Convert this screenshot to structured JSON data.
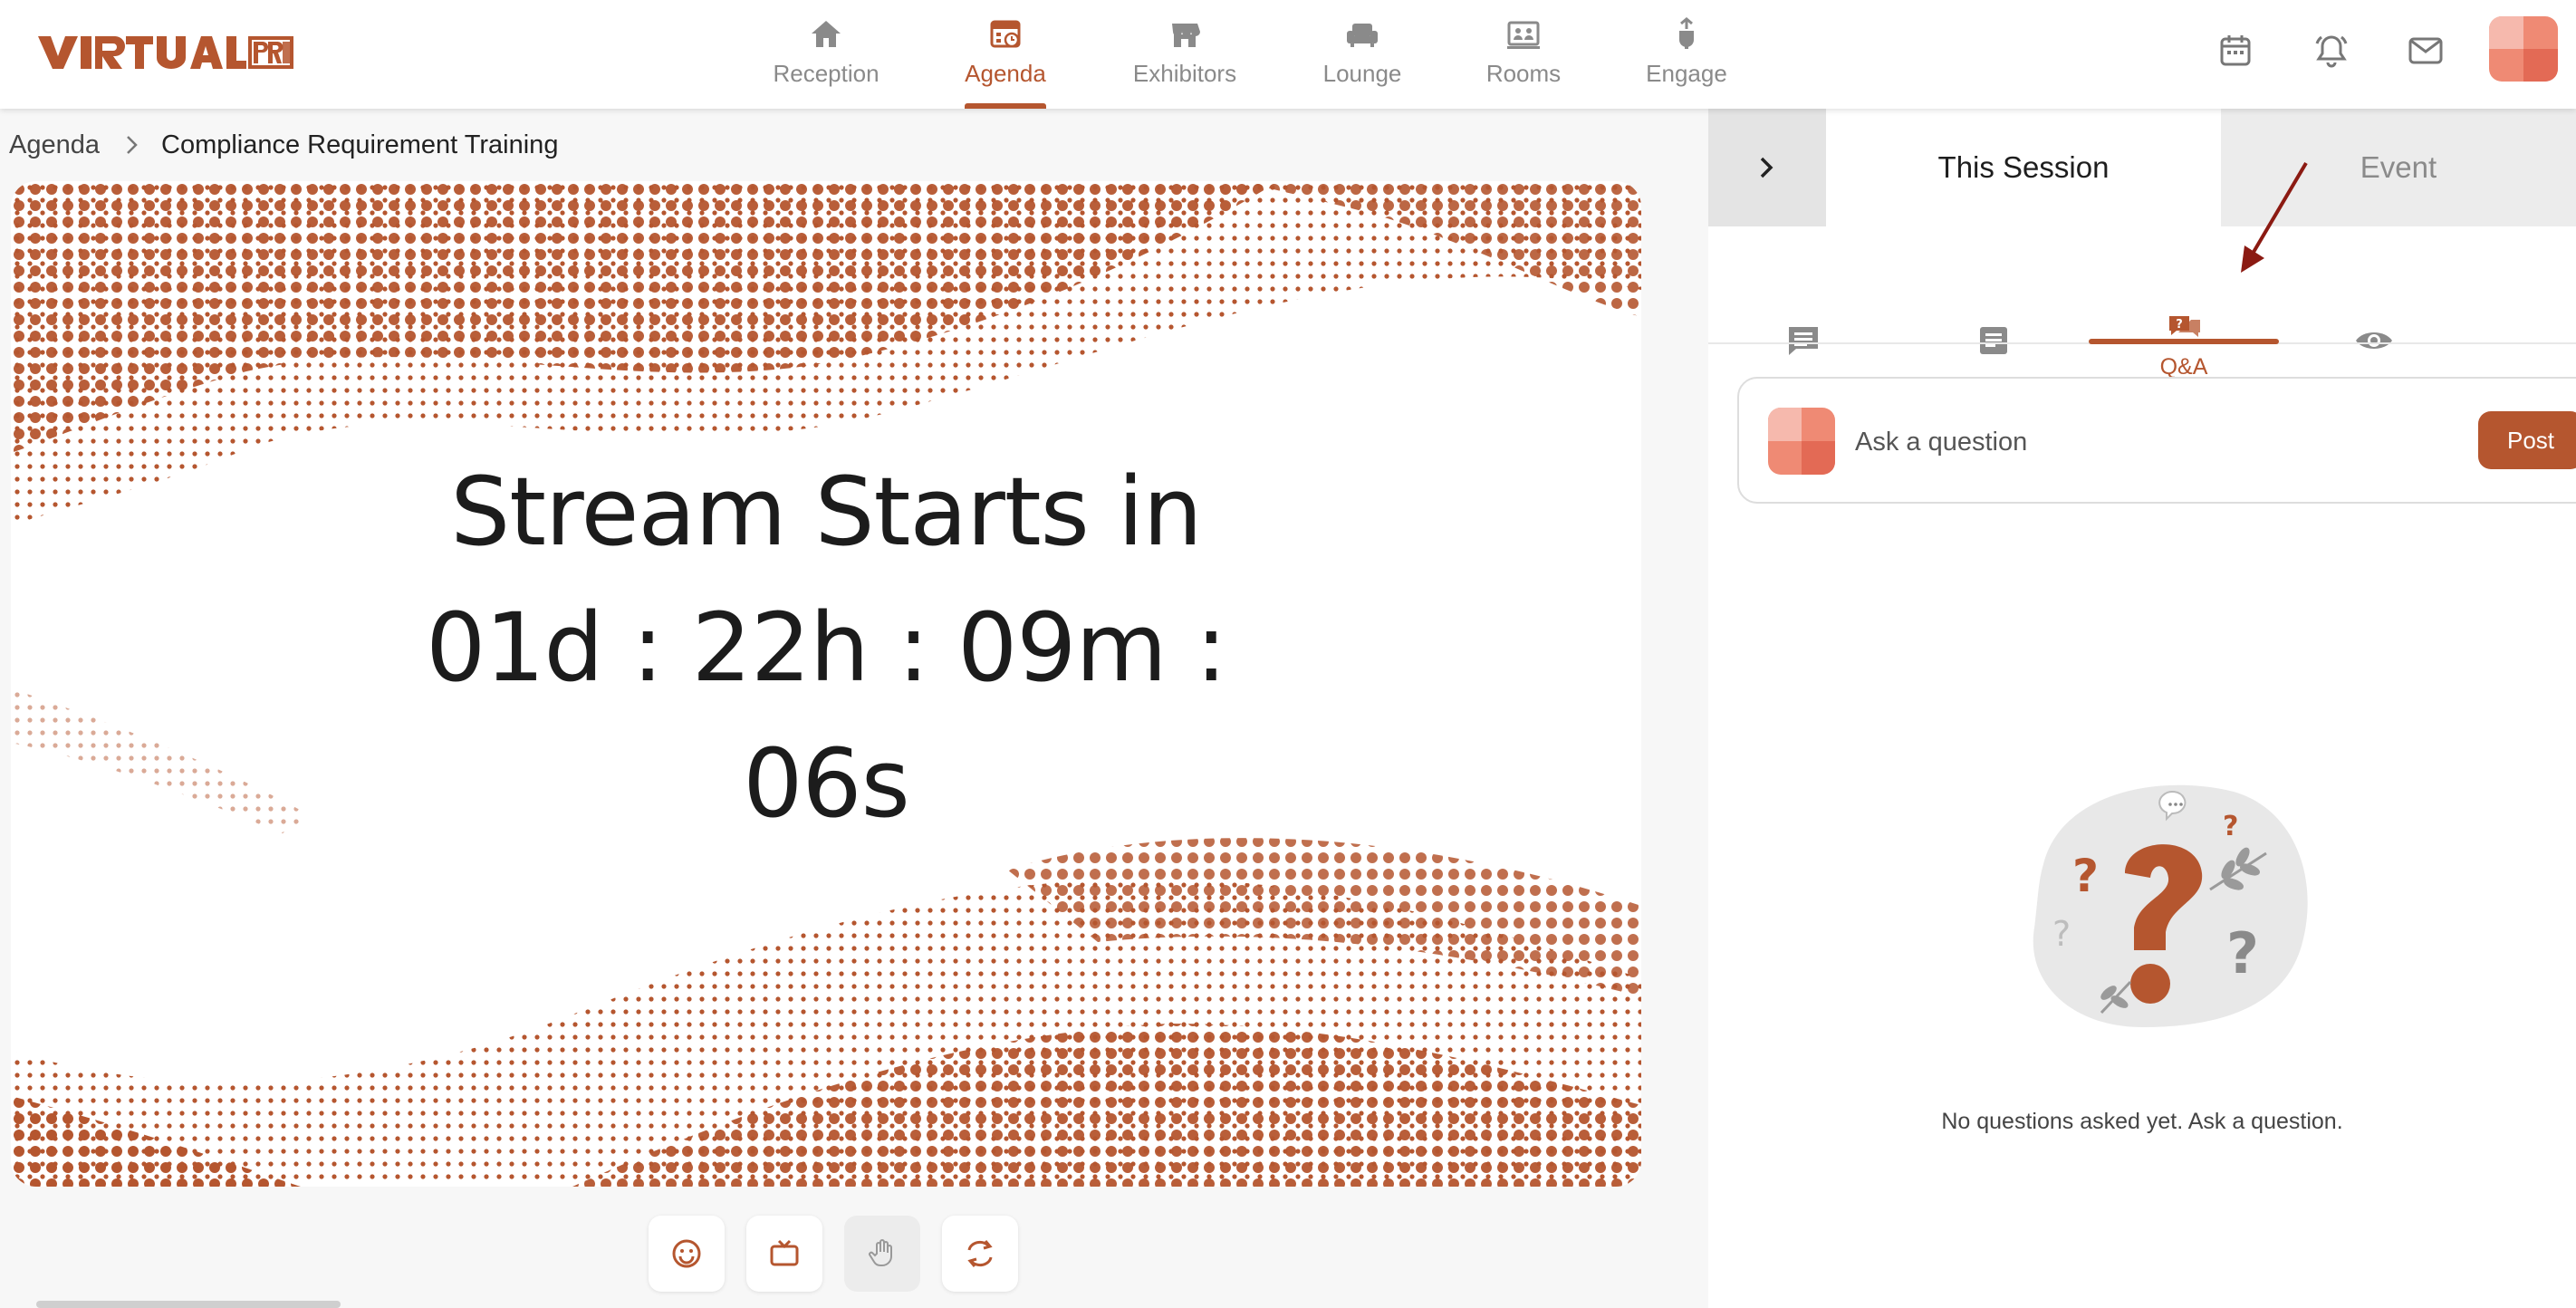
{
  "brand": {
    "logo_text": "VIRTUAL PRO",
    "accent": "#b5562f",
    "avatar_colors": [
      "#f6b9ad",
      "#ef8a74",
      "#e36a55"
    ]
  },
  "nav": {
    "items": [
      {
        "label": "Reception",
        "icon": "home-icon"
      },
      {
        "label": "Agenda",
        "icon": "calendar-schedule-icon",
        "active": true
      },
      {
        "label": "Exhibitors",
        "icon": "storefront-icon"
      },
      {
        "label": "Lounge",
        "icon": "armchair-icon"
      },
      {
        "label": "Rooms",
        "icon": "room-icon"
      },
      {
        "label": "Engage",
        "icon": "engage-icon"
      }
    ],
    "right_icons": [
      "calendar-icon",
      "bell-icon",
      "mail-icon",
      "avatar"
    ]
  },
  "breadcrumb": {
    "root": "Agenda",
    "current": "Compliance Requirement Training"
  },
  "stream": {
    "heading": "Stream Starts in",
    "countdown_line1": "01d : 22h : 09m :",
    "countdown_line2": "06s"
  },
  "controls": [
    "emoji-icon",
    "tv-icon",
    "raise-hand-icon",
    "swap-icon"
  ],
  "panel": {
    "tabs": {
      "this_session": "This Session",
      "event": "Event"
    },
    "subtabs": [
      {
        "icon": "chat-icon",
        "label": ""
      },
      {
        "icon": "notes-icon",
        "label": ""
      },
      {
        "icon": "qa-icon",
        "label": "Q&A",
        "active": true
      },
      {
        "icon": "eye-icon",
        "label": ""
      }
    ],
    "ask": {
      "placeholder": "Ask a question",
      "post_label": "Post"
    },
    "empty_message": "No questions asked yet. Ask a question."
  }
}
